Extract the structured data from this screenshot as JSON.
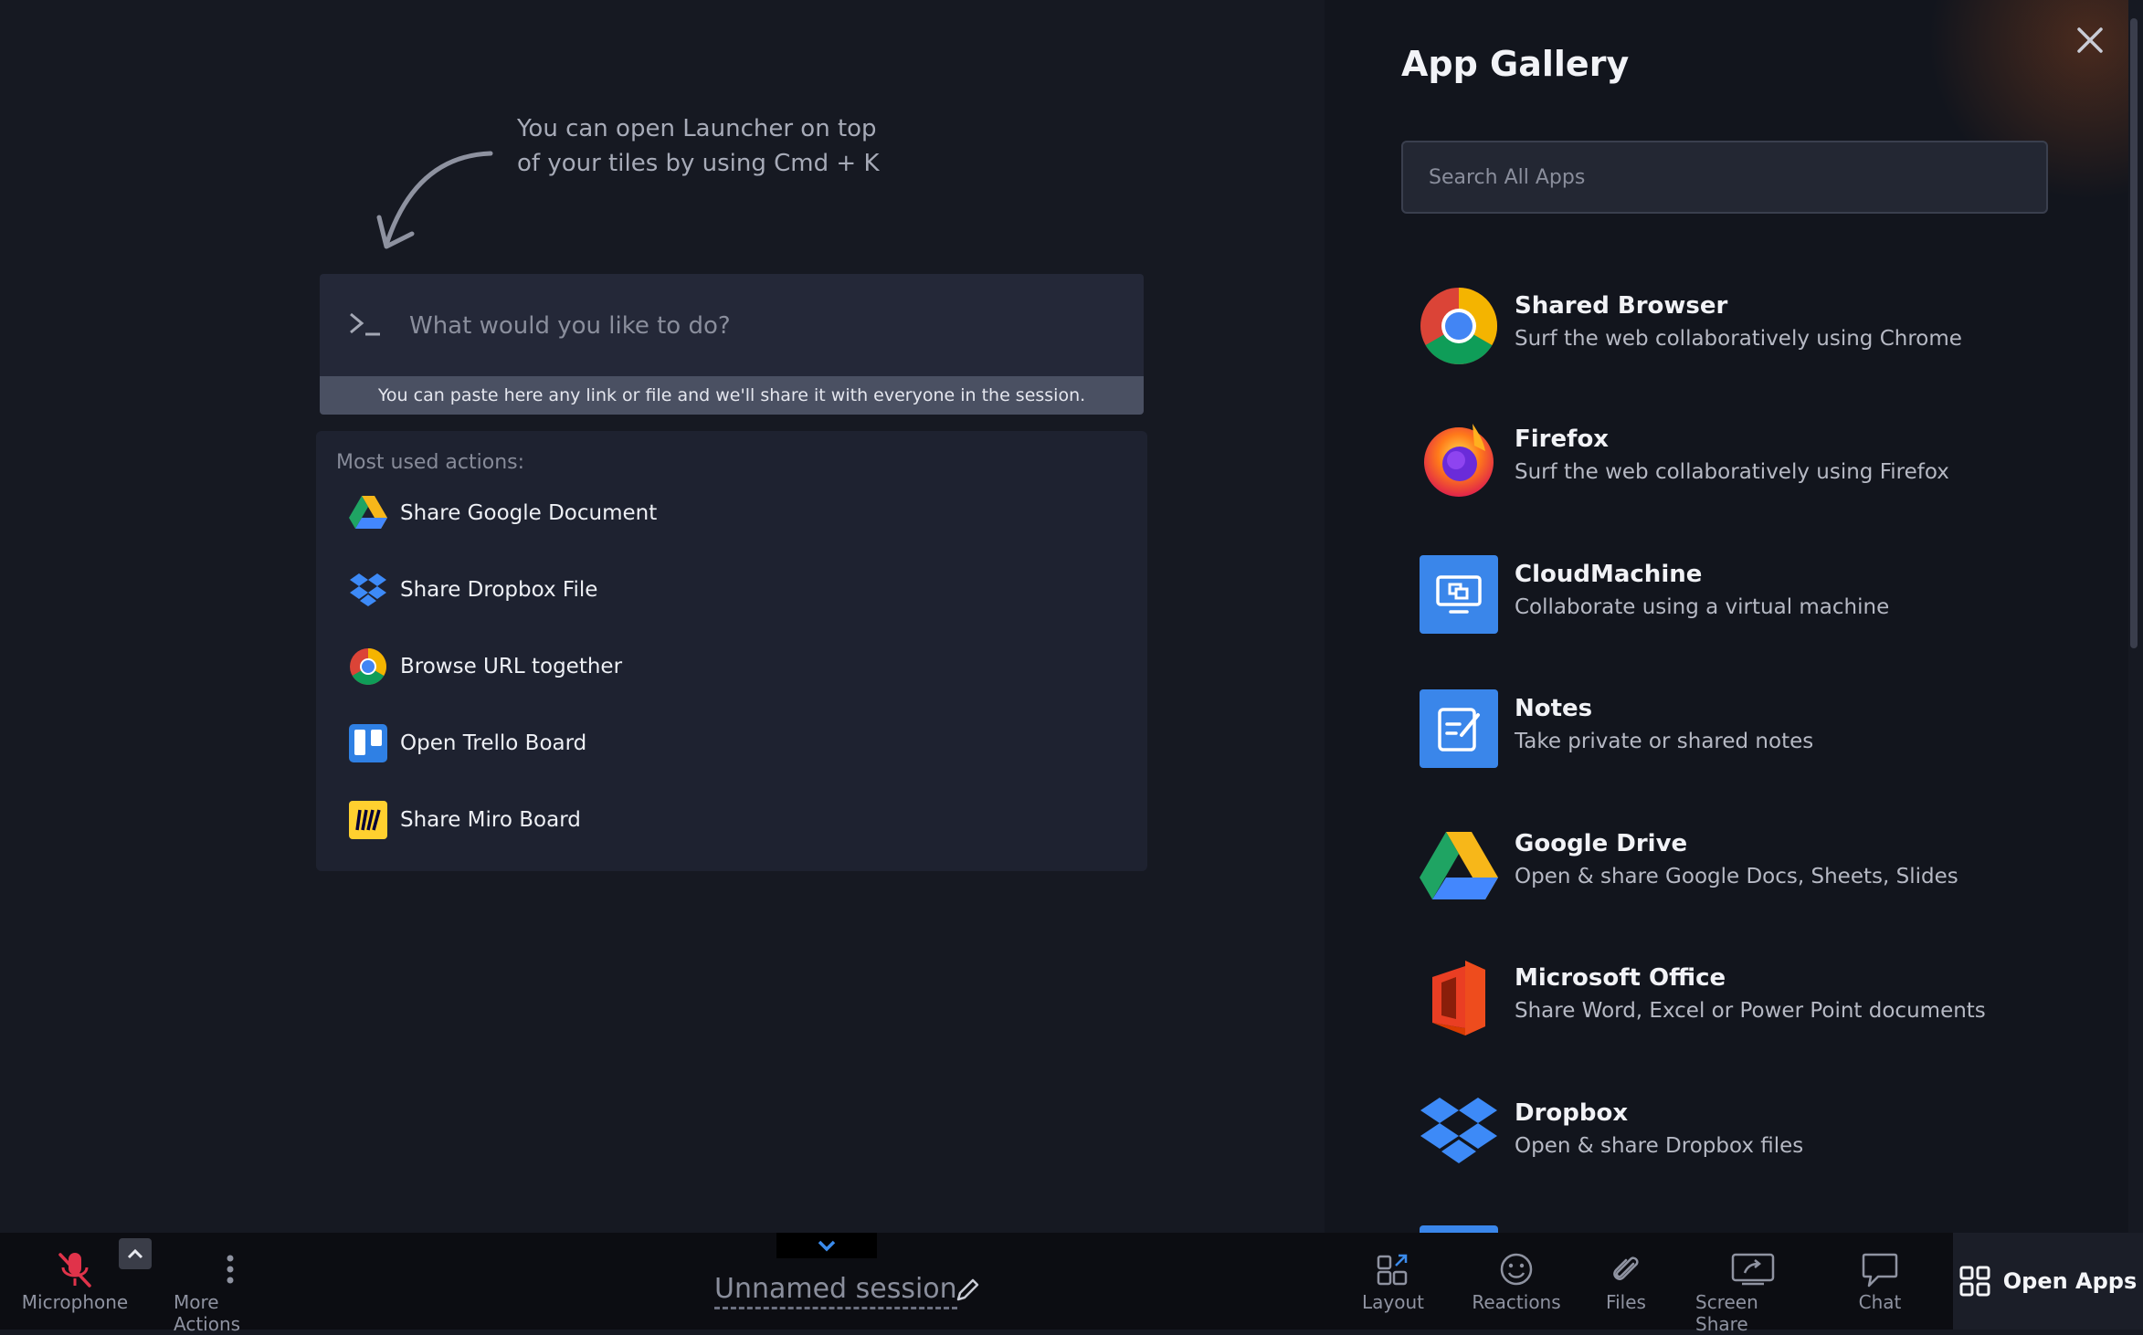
{
  "hint": {
    "line1": "You can open Launcher on top",
    "line2": "of your tiles by using Cmd + K"
  },
  "launcher": {
    "placeholder": "What would you like to do?",
    "paste_note": "You can paste here any link or file and we'll share it with everyone in the session."
  },
  "most_used": {
    "heading": "Most used actions:",
    "items": [
      {
        "label": "Share Google Document",
        "icon": "google-drive-icon"
      },
      {
        "label": "Share Dropbox File",
        "icon": "dropbox-icon"
      },
      {
        "label": "Browse URL together",
        "icon": "chrome-icon"
      },
      {
        "label": "Open Trello Board",
        "icon": "trello-icon"
      },
      {
        "label": "Share Miro Board",
        "icon": "miro-icon"
      }
    ]
  },
  "gallery": {
    "title": "App Gallery",
    "search_placeholder": "Search All Apps",
    "apps": [
      {
        "name": "Shared Browser",
        "desc": "Surf the web collaboratively using Chrome",
        "icon": "chrome-icon"
      },
      {
        "name": "Firefox",
        "desc": "Surf the web collaboratively using Firefox",
        "icon": "firefox-icon"
      },
      {
        "name": "CloudMachine",
        "desc": "Collaborate using a virtual machine",
        "icon": "cloudmachine-icon"
      },
      {
        "name": "Notes",
        "desc": "Take private or shared notes",
        "icon": "notes-icon"
      },
      {
        "name": "Google Drive",
        "desc": "Open & share Google Docs, Sheets, Slides",
        "icon": "google-drive-icon"
      },
      {
        "name": "Microsoft Office",
        "desc": "Share Word, Excel or Power Point documents",
        "icon": "office-icon"
      },
      {
        "name": "Dropbox",
        "desc": "Open & share Dropbox files",
        "icon": "dropbox-icon"
      }
    ]
  },
  "toolbar": {
    "microphone": "Microphone",
    "more_actions": "More Actions",
    "session_name": "Unnamed session",
    "layout": "Layout",
    "reactions": "Reactions",
    "files": "Files",
    "screen_share": "Screen Share",
    "chat": "Chat",
    "open_apps": "Open Apps"
  },
  "colors": {
    "background": "#161922",
    "panel": "#12151d",
    "mic_muted": "#e0334a",
    "accent": "#3b8beb"
  }
}
